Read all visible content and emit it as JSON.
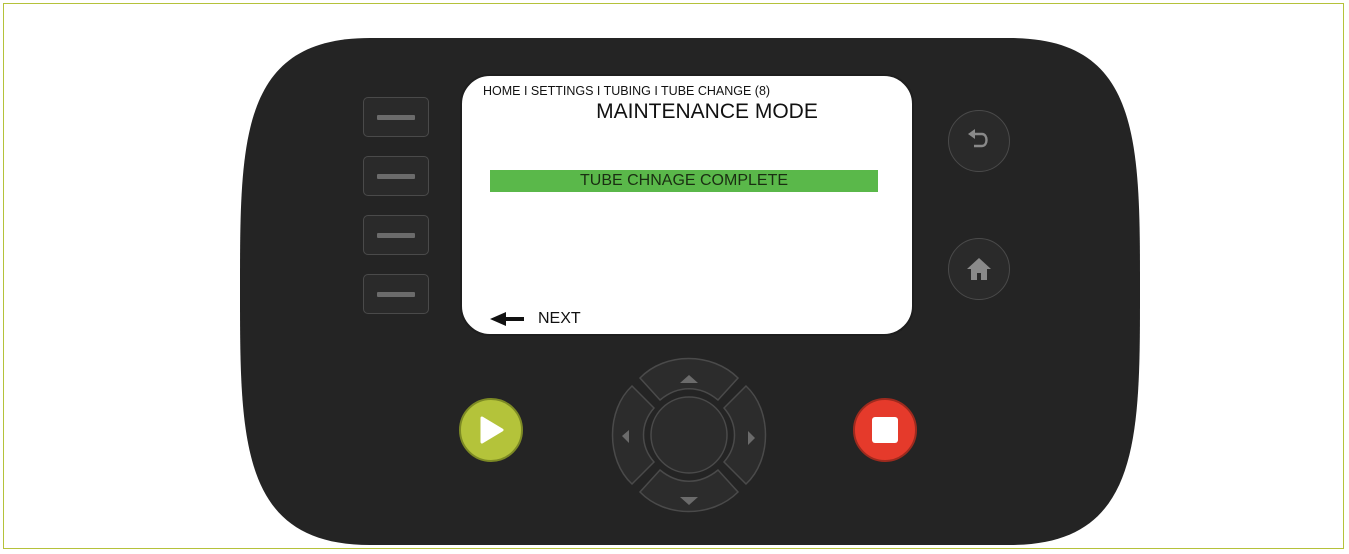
{
  "screen": {
    "breadcrumb": "HOME I SETTINGS I TUBING I TUBE CHANGE (8)",
    "title": "MAINTENANCE MODE",
    "status_message": "TUBE CHNAGE COMPLETE",
    "next_label": "NEXT"
  },
  "soft_keys": [
    {
      "name": "soft-key-1"
    },
    {
      "name": "soft-key-2"
    },
    {
      "name": "soft-key-3"
    },
    {
      "name": "soft-key-4"
    }
  ],
  "buttons": {
    "back": {
      "icon": "back-arrow-icon"
    },
    "home": {
      "icon": "home-icon"
    },
    "play": {
      "icon": "play-icon",
      "color": "#b4c33a"
    },
    "stop": {
      "icon": "stop-icon",
      "color": "#e53a2b"
    }
  },
  "dpad": {
    "up": "chevron-up-icon",
    "down": "chevron-down-icon",
    "left": "chevron-left-icon",
    "right": "chevron-right-icon"
  },
  "colors": {
    "frame_border": "#b5c23a",
    "device_body": "#242424",
    "status_bar": "#5ab84a"
  }
}
